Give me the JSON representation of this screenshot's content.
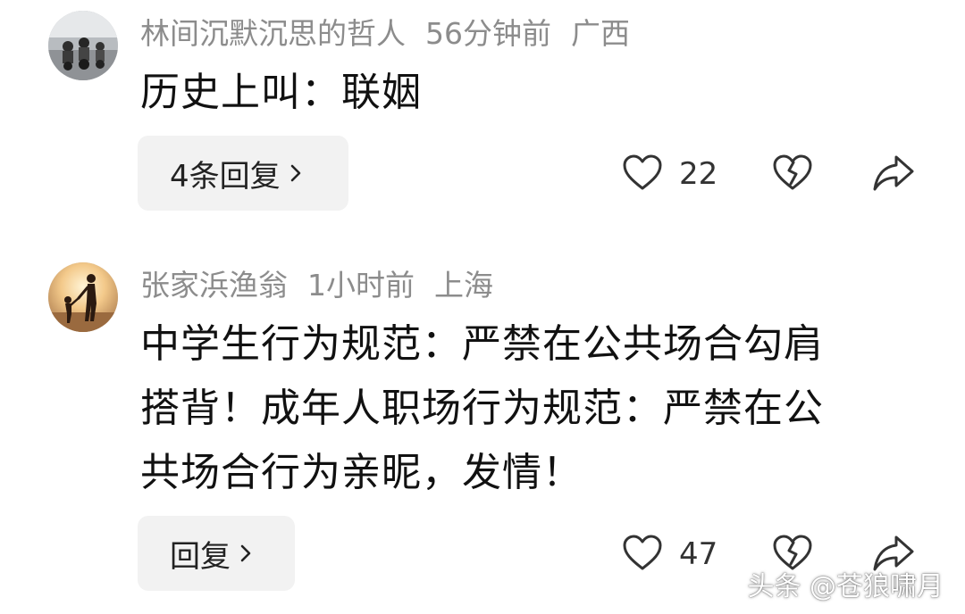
{
  "comments": [
    {
      "username": "林间沉默沉思的哲人",
      "time": "56分钟前",
      "location": "广西",
      "content": "历史上叫：联姻",
      "reply_label": "4条回复",
      "likes": "22",
      "avatar_icon": "motorcycle-riders-photo"
    },
    {
      "username": "张家浜渔翁",
      "time": "1小时前",
      "location": "上海",
      "content_lines": [
        "中学生行为规范：严禁在公共场合勾肩",
        "搭背！成年人职场行为规范：严禁在公",
        "共场合行为亲昵，发情！"
      ],
      "reply_label": "回复",
      "likes": "47",
      "avatar_icon": "sunset-parent-child-photo"
    }
  ],
  "icons": {
    "like": "heart-icon",
    "dislike": "broken-heart-icon",
    "share": "share-arrow-icon",
    "reply_chevron": "chevron-right-icon"
  },
  "watermark": "头条 @苍狼啸月",
  "colors": {
    "meta_text": "#8c8c8c",
    "body_text": "#111111",
    "reply_bg": "#f2f2f2",
    "icon_stroke": "#333333"
  }
}
